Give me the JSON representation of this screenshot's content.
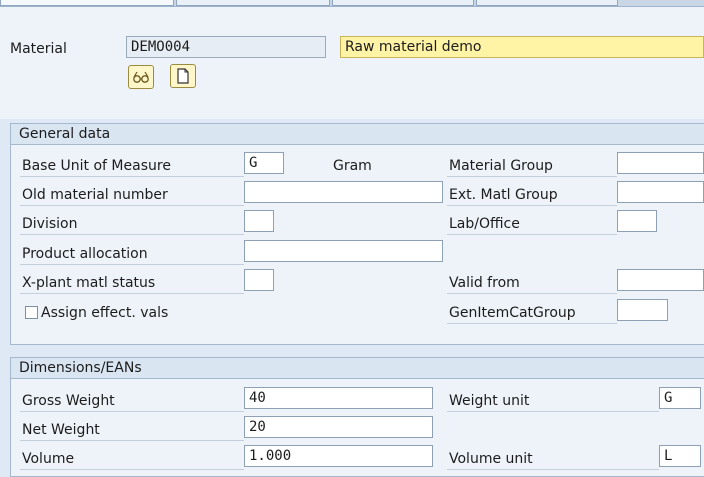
{
  "header": {
    "material_label": "Material",
    "material_value": "DEMO004",
    "description_value": "Raw material demo",
    "display_icon": "glasses-icon",
    "document_icon": "document-icon"
  },
  "general": {
    "title": "General data",
    "base_uom_label": "Base Unit of Measure",
    "base_uom_value": "G",
    "base_uom_text": "Gram",
    "material_group_label": "Material Group",
    "material_group_value": "",
    "old_matnr_label": "Old material number",
    "old_matnr_value": "",
    "ext_group_label": "Ext. Matl Group",
    "ext_group_value": "",
    "division_label": "Division",
    "division_value": "",
    "lab_label": "Lab/Office",
    "lab_value": "",
    "prod_alloc_label": "Product allocation",
    "prod_alloc_value": "",
    "xplant_label": "X-plant matl status",
    "xplant_value": "",
    "valid_from_label": "Valid from",
    "valid_from_value": "",
    "assign_label": "Assign effect. vals",
    "assign_checked": false,
    "genitem_label": "GenItemCatGroup",
    "genitem_value": ""
  },
  "dimensions": {
    "title": "Dimensions/EANs",
    "gross_label": "Gross Weight",
    "gross_value": "40",
    "weight_unit_label": "Weight unit",
    "weight_unit_value": "G",
    "net_label": "Net Weight",
    "net_value": "20",
    "volume_label": "Volume",
    "volume_value": "1.000",
    "volume_unit_label": "Volume unit",
    "volume_unit_value": "L"
  }
}
